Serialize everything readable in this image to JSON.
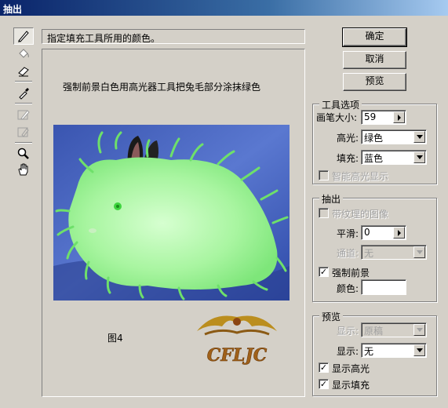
{
  "window": {
    "title": "抽出"
  },
  "hint_text": "指定填充工具所用的颜色。",
  "canvas": {
    "instruction": "强制前景白色用高光器工具把兔毛部分涂抹绿色",
    "figure_label": "图4",
    "watermark": "CFLJC"
  },
  "buttons": {
    "ok": "确定",
    "cancel": "取消",
    "preview": "预览"
  },
  "tool_options": {
    "legend": "工具选项",
    "brush_size_label": "画笔大小:",
    "brush_size_value": "59",
    "highlight_label": "高光:",
    "highlight_value": "绿色",
    "fill_label": "填充:",
    "fill_value": "蓝色",
    "smart_highlight_label": "智能高光显示"
  },
  "extraction": {
    "legend": "抽出",
    "textured_label": "带纹理的图像",
    "smooth_label": "平滑:",
    "smooth_value": "0",
    "channel_label": "通道:",
    "channel_value": "无",
    "force_fg_label": "强制前景",
    "color_label": "颜色:",
    "color_value": "#ffffff"
  },
  "preview": {
    "legend": "预览",
    "show_label": "显示:",
    "show_value": "原稿",
    "show2_label": "显示:",
    "show2_value": "无",
    "show_highlight_label": "显示高光",
    "show_fill_label": "显示填充"
  },
  "icons": [
    "edge-highlighter-icon",
    "fill-bucket-icon",
    "eraser-icon",
    "eyedropper-icon",
    "cleanup-icon",
    "edge-touchup-icon",
    "zoom-icon",
    "hand-icon"
  ]
}
